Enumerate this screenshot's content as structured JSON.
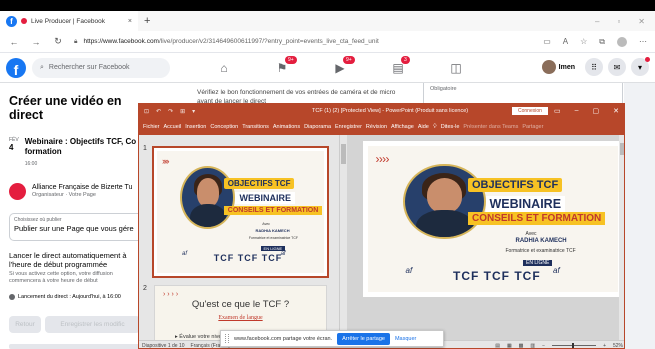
{
  "browser": {
    "tab_title": "Live Producer | Facebook",
    "tab_close": "×",
    "new_tab": "+",
    "window_controls": [
      "–",
      "▫",
      "✕"
    ],
    "url_host": "https://www.facebook.com",
    "url_path": "/live/producer/v2/314649600611997/?entry_point=events_live_cta_feed_unit"
  },
  "fb_header": {
    "logo": "f",
    "search_placeholder": "Rechercher sur Facebook",
    "nav": [
      {
        "icon": "home-icon",
        "glyph": "⌂",
        "badge": ""
      },
      {
        "icon": "flag-icon",
        "glyph": "⚑",
        "badge": "9+"
      },
      {
        "icon": "video-icon",
        "glyph": "▶",
        "badge": "9+"
      },
      {
        "icon": "store-icon",
        "glyph": "▤",
        "badge": "3"
      },
      {
        "icon": "gaming-icon",
        "glyph": "◫",
        "badge": ""
      }
    ],
    "profile_name": "Imen",
    "menu_glyph": "⋮⋮⋮",
    "messenger_glyph": "✉",
    "account_glyph": "▾"
  },
  "left_panel": {
    "title": "Créer une vidéo en direct",
    "event": {
      "month": "FÉV",
      "day": "4",
      "title": "Webinaire : Objectifs TCF, Co formation",
      "time": "16:00"
    },
    "organizer": {
      "name": "Alliance Française de Bizerte Tu",
      "role": "Organisateur · Votre Page"
    },
    "choose": {
      "label": "Choisissez où publier",
      "value": "Publier sur une Page que vous gére"
    },
    "auto": {
      "heading": "Lancer le direct automatiquement à l'heure de début programmée",
      "desc": "Si vous activez cette option, votre diffusion commencera à votre heure de début"
    },
    "launch": "Lancement du direct : Aujourd'hui, à 16:00",
    "buttons": {
      "back": "Retour",
      "save": "Enregistrer les modific"
    }
  },
  "center_bg_text": "Vérifiez le bon fonctionnement de vos entrées de caméra et de micro avant de lancer le direct",
  "right_bg_text": "Obligatoire",
  "powerpoint": {
    "quick_access": [
      "⊡",
      "↶",
      "↷",
      "⊞",
      "▾"
    ],
    "title": "TCF (1) (2) [Protected View] - PowerPoint (Produit sans licence)",
    "connect": "Connexion",
    "window_controls": [
      "▭",
      "–",
      "▢",
      "✕"
    ],
    "ribbon": [
      "Fichier",
      "Accueil",
      "Insertion",
      "Conception",
      "Transitions",
      "Animations",
      "Diaporama",
      "Enregistrer",
      "Révision",
      "Affichage",
      "Aide"
    ],
    "tell_me": "Dites-le",
    "ribbon_faded": [
      "Présenter dans Teams",
      "Partager"
    ],
    "slide_numbers": [
      "1",
      "2"
    ],
    "slide1": {
      "arrows": "› › › ›",
      "line1": "OBJECTIFS TCF",
      "line2": "WEBINAIRE",
      "line3": "CONSEILS ET FORMATION",
      "avec": "Avec",
      "speaker": "RADHIA KAMECH",
      "role": "Formatrice et examinatrice TCF",
      "live": "EN LIGNE",
      "af": "af",
      "tcf": "TCF TCF TCF"
    },
    "slide2": {
      "arrows": "› › › ›",
      "question": "Qu'est ce que le TCF ?",
      "sub": "Examen de langue",
      "bullet": "▸ Évalue votre niveau..."
    },
    "status": {
      "slide": "Diapositive 1 de 10",
      "language": "Français (France)",
      "zoom": "52%"
    }
  },
  "share_bar": {
    "message": "www.facebook.com partage votre écran.",
    "stop": "Arrêter le partage",
    "hide": "Masquer"
  }
}
